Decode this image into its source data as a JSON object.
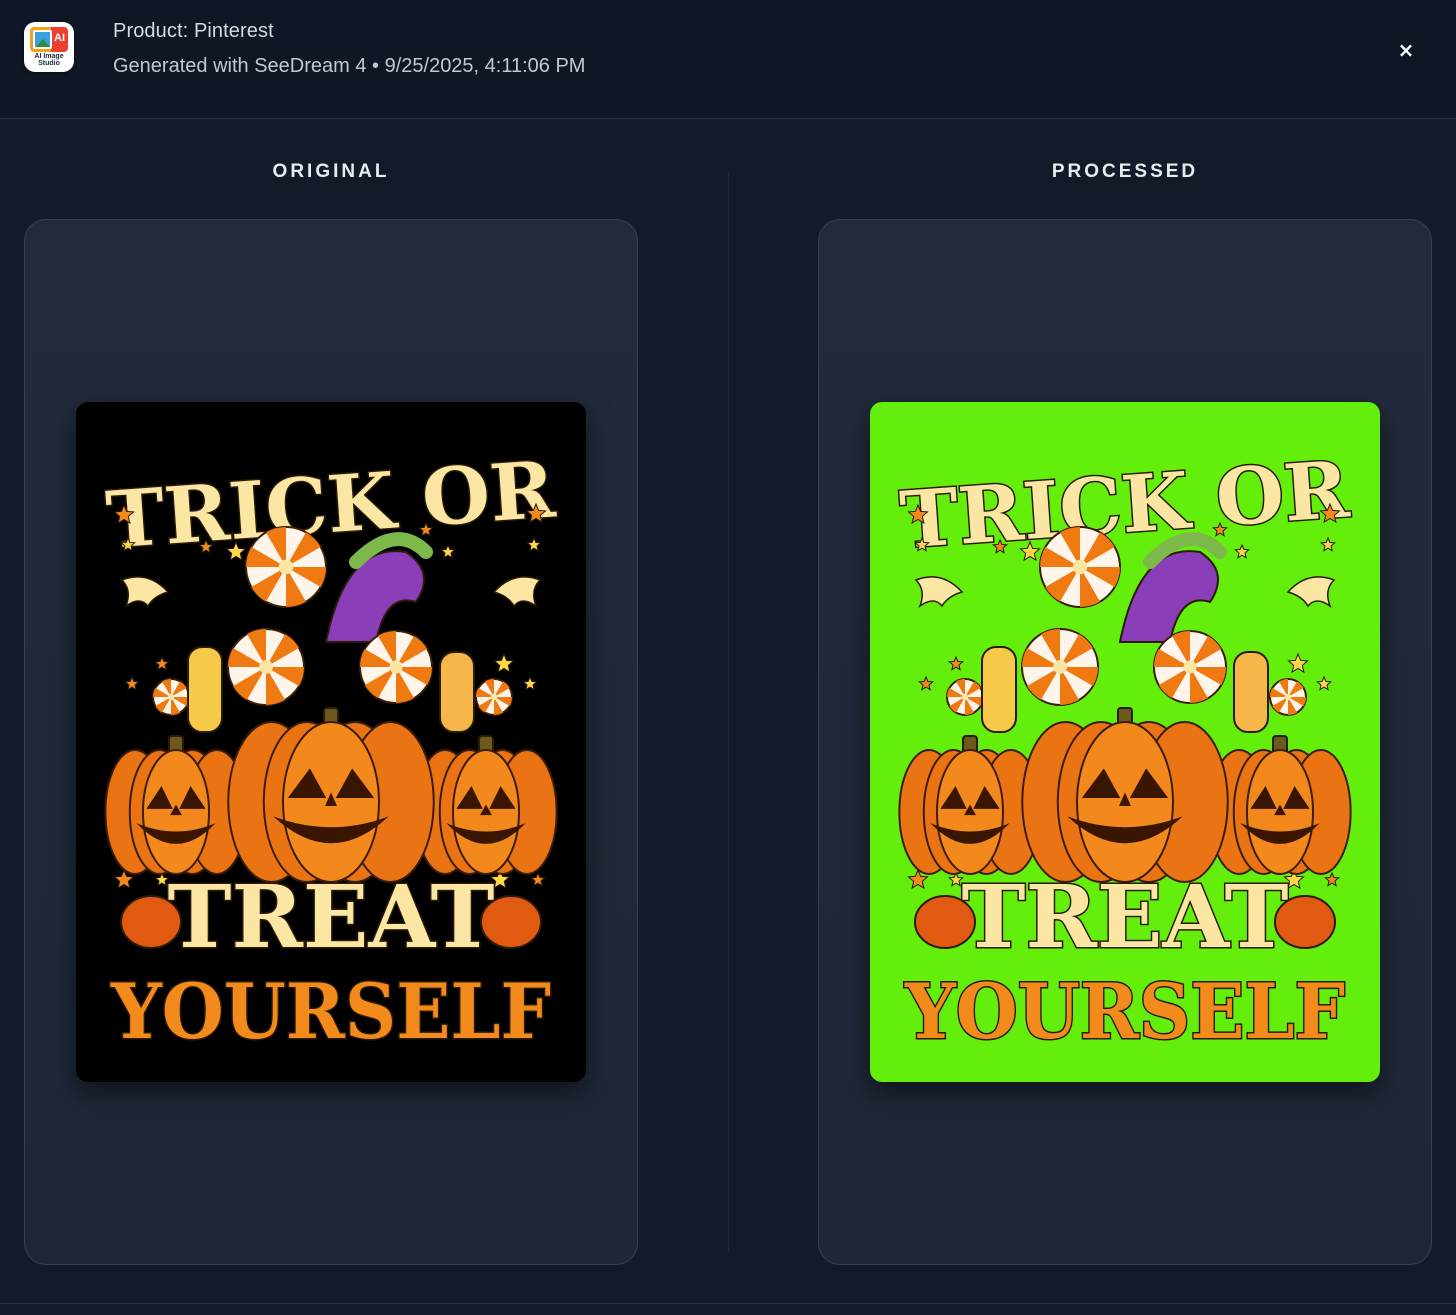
{
  "header": {
    "logo_label_line1": "AI Image",
    "logo_label_line2": "Studio",
    "logo_badge": "AI",
    "title": "Product: Pinterest",
    "subtitle": "Generated with SeeDream 4 • 9/25/2025, 4:11:06 PM",
    "close_label": "×"
  },
  "panels": [
    {
      "label": "ORIGINAL",
      "background_color": "#000000",
      "poster_text": {
        "line1": "TRICK OR",
        "line2": "TREAT",
        "line3": "YOURSELF"
      }
    },
    {
      "label": "PROCESSED",
      "background_color": "#63ee0c",
      "poster_text": {
        "line1": "TRICK OR",
        "line2": "TREAT",
        "line3": "YOURSELF"
      }
    }
  ],
  "colors": {
    "accent_cream": "#fbe7a3",
    "accent_orange": "#f28a1c",
    "pumpkin": "#f07a12"
  }
}
